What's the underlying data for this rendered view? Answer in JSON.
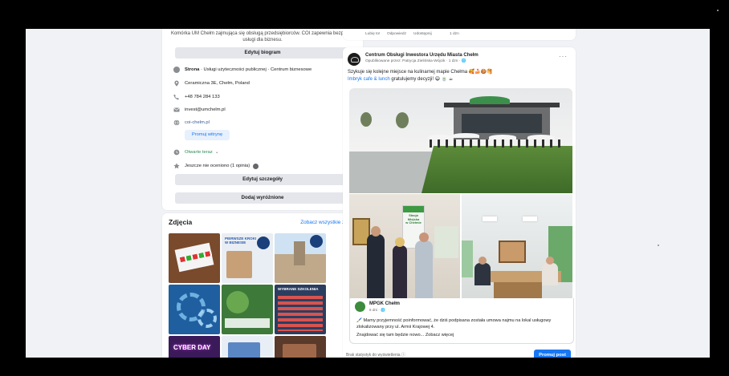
{
  "intro": {
    "bio": "Komórka UM Chełm zajmująca się obsługą przedsiębiorców. COI zapewnia bezpłatne usługi dla biznesu.",
    "edit_bio": "Edytuj biogram",
    "category_bold": "Strona",
    "category_rest": " · Usługi użyteczności publicznej · Centrum biznesowe",
    "address": "Ceramiczna 3E, Chełm, Poland",
    "phone": "+48 784 284 133",
    "email": "invest@umchelm.pl",
    "website": "coi-chelm.pl",
    "promote_site": "Promuj witrynę",
    "hours": "Otwarte teraz",
    "hours_chevron": "⌄",
    "rating": "Jeszcze nie oceniono (1 opinia)",
    "edit_details": "Edytuj szczegóły",
    "add_featured": "Dodaj wyróżnione"
  },
  "photos": {
    "title": "Zdjęcia",
    "see_all": "Zobacz wszystkie zdjęcia",
    "thumb_texts": [
      "PIERWSZE KROKI W BIZNESIE",
      "WYBRANE SZKOLENIA",
      "CYBER DAY"
    ]
  },
  "previous_post_actions": {
    "like": "Lubię to!",
    "reply": "Odpowiedz",
    "share": "Udostępnij",
    "time": "1 dzn"
  },
  "post": {
    "author": "Centrum Obsługi Inwestora Urzędu Miasta Chełm",
    "meta": "Opublikowane przez: Patrycja Zielińska-Wójcik · 1 dzn · 🌐",
    "menu": "···",
    "text_line1": "Szykuje się kolejne miejsce na kulinarnej mapie Chełma 🥰🍰🍪🥞",
    "text_link": "Imbryk cafe & lunch",
    "text_line2": " gratulujemy decyzji! 😄 🍵 ☕",
    "sign_text_1": "Stacja",
    "sign_text_2": "Miejska",
    "sign_text_3": "w Chełmie"
  },
  "shared_post": {
    "author": "MPGK Chełm",
    "meta": "6 dni · 🌐",
    "text": "🖌️ Mamy przyjemność poinformować, że dziś podpisana została umowa najmu na lokal usługowy zlokalizowany przy ul. Armii Krajowej 4.",
    "text2": "Znajdować się tam będzie nowo... Zobacz więcej"
  },
  "post_footer": {
    "stats": "Brak statystyk do wyświetlenia ⓘ",
    "boost": "Promuj post"
  },
  "colors": {
    "accent": "#1877f2",
    "link": "#385898",
    "open": "#2e8b57",
    "bg": "#f0f2f5"
  }
}
